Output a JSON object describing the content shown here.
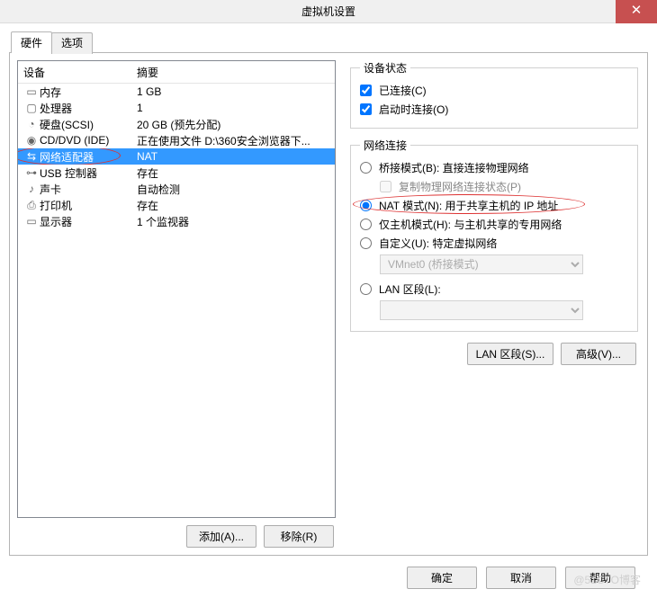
{
  "window": {
    "title": "虚拟机设置"
  },
  "tabs": {
    "hardware": "硬件",
    "options": "选项"
  },
  "list": {
    "col_device": "设备",
    "col_summary": "摘要",
    "rows": [
      {
        "icon": "▭",
        "name": "内存",
        "summary": "1 GB"
      },
      {
        "icon": "▢",
        "name": "处理器",
        "summary": "1"
      },
      {
        "icon": "◔",
        "name": "硬盘(SCSI)",
        "summary": "20 GB (预先分配)"
      },
      {
        "icon": "◉",
        "name": "CD/DVD (IDE)",
        "summary": "正在使用文件 D:\\360安全浏览器下..."
      },
      {
        "icon": "⇆",
        "name": "网络适配器",
        "summary": "NAT"
      },
      {
        "icon": "⊶",
        "name": "USB 控制器",
        "summary": "存在"
      },
      {
        "icon": "♪",
        "name": "声卡",
        "summary": "自动检测"
      },
      {
        "icon": "⎙",
        "name": "打印机",
        "summary": "存在"
      },
      {
        "icon": "▭",
        "name": "显示器",
        "summary": "1 个监视器"
      }
    ]
  },
  "left_buttons": {
    "add": "添加(A)...",
    "remove": "移除(R)"
  },
  "status_group": {
    "legend": "设备状态",
    "connected": "已连接(C)",
    "connect_on": "启动时连接(O)"
  },
  "net_group": {
    "legend": "网络连接",
    "bridged": "桥接模式(B): 直接连接物理网络",
    "replicate": "复制物理网络连接状态(P)",
    "nat": "NAT 模式(N): 用于共享主机的 IP 地址",
    "hostonly": "仅主机模式(H): 与主机共享的专用网络",
    "custom": "自定义(U): 特定虚拟网络",
    "vnet_option": "VMnet0 (桥接模式)",
    "lan": "LAN 区段(L):",
    "lan_option": ""
  },
  "rp_buttons": {
    "lanseg": "LAN 区段(S)...",
    "advanced": "高级(V)..."
  },
  "footer": {
    "ok": "确定",
    "cancel": "取消",
    "help": "帮助"
  },
  "watermark": "@51CTO博客"
}
